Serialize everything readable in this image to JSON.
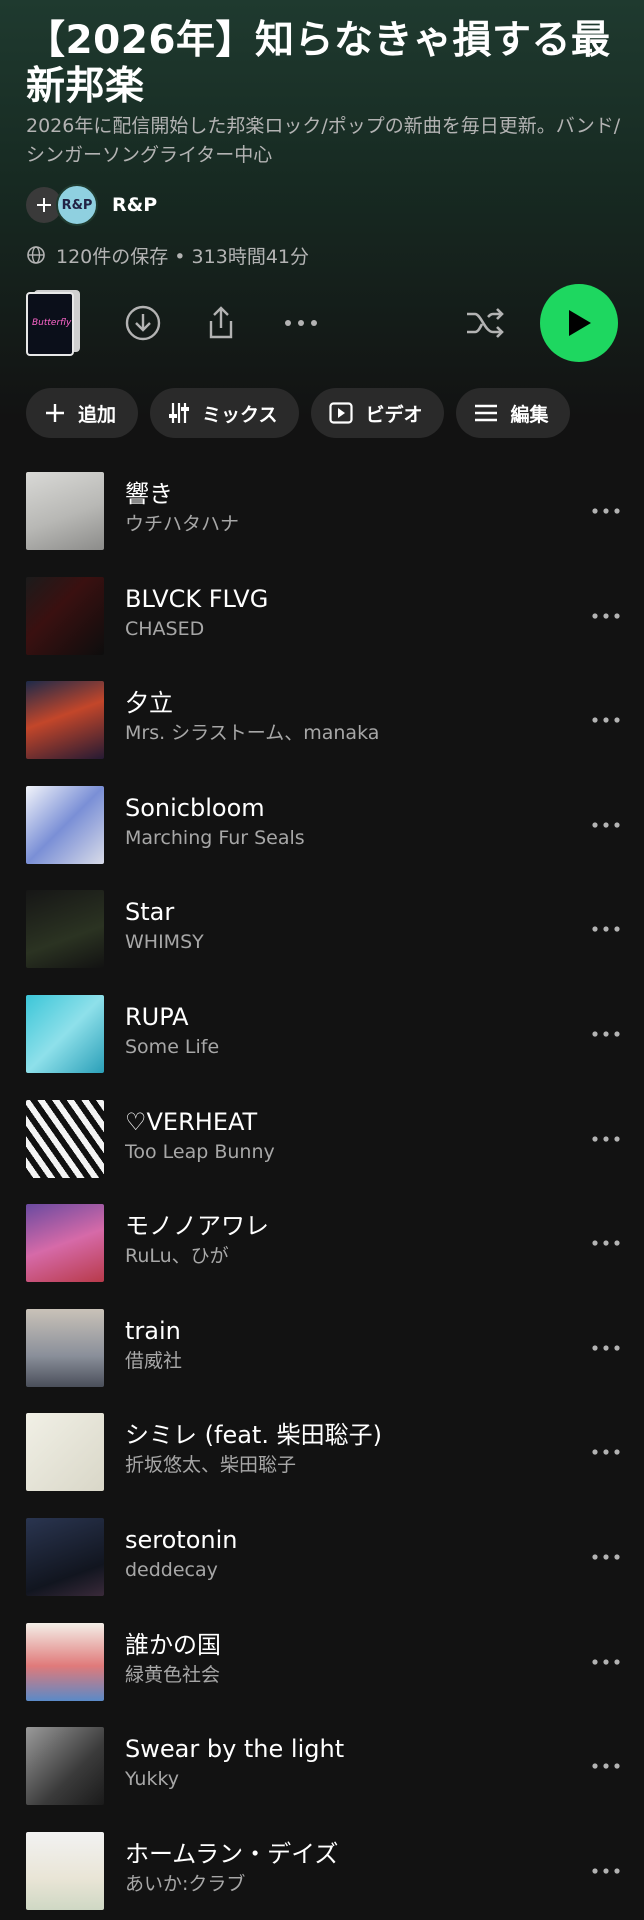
{
  "header": {
    "title": "【2026年】知らなきゃ損する最新邦楽",
    "description": "2026年に配信開始した邦楽ロック/ポップの新曲を毎日更新。バンド/シンガーソングライター中心",
    "owner_name": "R&P",
    "owner_avatar_text": "R&P",
    "stats": "120件の保存 • 313時間41分",
    "cover_text": "Butterfly"
  },
  "actions": {
    "download_icon": "download-icon",
    "share_icon": "share-icon",
    "more_icon": "more-horizontal-icon",
    "shuffle_icon": "shuffle-icon",
    "play_icon": "play-icon",
    "play_color": "#1ed760"
  },
  "chips": [
    {
      "label": "追加",
      "icon": "plus-icon"
    },
    {
      "label": "ミックス",
      "icon": "sliders-icon"
    },
    {
      "label": "ビデオ",
      "icon": "video-icon"
    },
    {
      "label": "編集",
      "icon": "menu-icon"
    }
  ],
  "tracks": [
    {
      "title": "響き",
      "artist": "ウチハタハナ",
      "art": "linear-gradient(160deg,#d9d9d6 0%,#b8b8b5 55%,#8c8c8a 100%)"
    },
    {
      "title": "BLVCK FLVG",
      "artist": "CHASED",
      "art": "linear-gradient(135deg,#1b1b1b 0%,#3a1010 40%,#0d0d0d 100%)"
    },
    {
      "title": "夕立",
      "artist": "Mrs. シラストーム、manaka",
      "art": "linear-gradient(160deg,#1d2a4a 0%,#c3462a 45%,#251a33 100%)"
    },
    {
      "title": "Sonicbloom",
      "artist": "Marching Fur Seals",
      "art": "linear-gradient(135deg,#f2f4fa 0%,#7a8fd6 50%,#d8dbe8 100%)"
    },
    {
      "title": "Star",
      "artist": "WHIMSY",
      "art": "linear-gradient(160deg,#161616 0%,#2b3322 60%,#121212 100%)"
    },
    {
      "title": "RUPA",
      "artist": "Some Life",
      "art": "linear-gradient(135deg,#3cc6d8 0%,#8ee0ea 50%,#2a9fb8 100%)"
    },
    {
      "title": "♡VERHEAT",
      "artist": "Too Leap Bunny",
      "art": "repeating-linear-gradient(55deg,#111 0 6px,#f4f4f4 6px 12px)"
    },
    {
      "title": "モノノアワレ",
      "artist": "RuLu、ひが",
      "art": "linear-gradient(160deg,#6a4aa0 0%,#d66aa8 50%,#b83a4a 100%)"
    },
    {
      "title": "train",
      "artist": "借威社",
      "art": "linear-gradient(180deg,#c9c2b8 0%,#8a8f9a 60%,#4a4f5a 100%)"
    },
    {
      "title": "シミレ (feat. 柴田聡子)",
      "artist": "折坂悠太、柴田聡子",
      "art": "linear-gradient(135deg,#f1f0e6 0%,#d9d7c8 100%)"
    },
    {
      "title": "serotonin",
      "artist": "deddecay",
      "art": "linear-gradient(160deg,#2a3550 0%,#11151f 70%,#3a2a3a 100%)"
    },
    {
      "title": "誰かの国",
      "artist": "緑黄色社会",
      "art": "linear-gradient(180deg,#f4efe8 0%,#e07a7a 55%,#5a8ac8 100%)"
    },
    {
      "title": "Swear by the light",
      "artist": "Yukky",
      "art": "linear-gradient(135deg,#9a9a9a 0%,#3b3b3b 60%,#1a1a1a 100%)"
    },
    {
      "title": "ホームラン・デイズ",
      "artist": "あいか:クラブ",
      "art": "linear-gradient(180deg,#f2f2f2 0%,#e9e5d6 60%,#cfd8c4 100%)"
    }
  ]
}
